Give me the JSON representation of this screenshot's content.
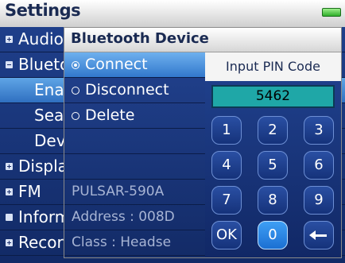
{
  "settings": {
    "title": "Settings",
    "menu": [
      {
        "label": "Audio",
        "expander": "plus"
      },
      {
        "label": "Bluetooth",
        "expander": "minus"
      },
      {
        "label": "Enable",
        "sub": true,
        "selected": true
      },
      {
        "label": "Search",
        "sub": true
      },
      {
        "label": "Device",
        "sub": true
      },
      {
        "label": "Display",
        "expander": "plus"
      },
      {
        "label": "FM",
        "expander": "plus"
      },
      {
        "label": "Information",
        "expander": "dot"
      },
      {
        "label": "Record",
        "expander": "plus"
      }
    ]
  },
  "bluetooth_device": {
    "title": "Bluetooth Device",
    "actions": [
      {
        "label": "Connect",
        "selected": true
      },
      {
        "label": "Disconnect"
      },
      {
        "label": "Delete"
      }
    ],
    "device_name": "PULSAR-590A",
    "address": "Address : 008D",
    "class": "Class : Headse"
  },
  "pin": {
    "label": "Input PIN Code",
    "value": "5462",
    "keys": [
      "1",
      "2",
      "3",
      "4",
      "5",
      "6",
      "7",
      "8",
      "9",
      "OK",
      "0",
      "backspace"
    ],
    "selected_key": "0"
  },
  "colors": {
    "menu_blue": "#1f3f8a",
    "highlight_blue": "#3278cc",
    "pin_display_teal": "#1fa7a7"
  }
}
